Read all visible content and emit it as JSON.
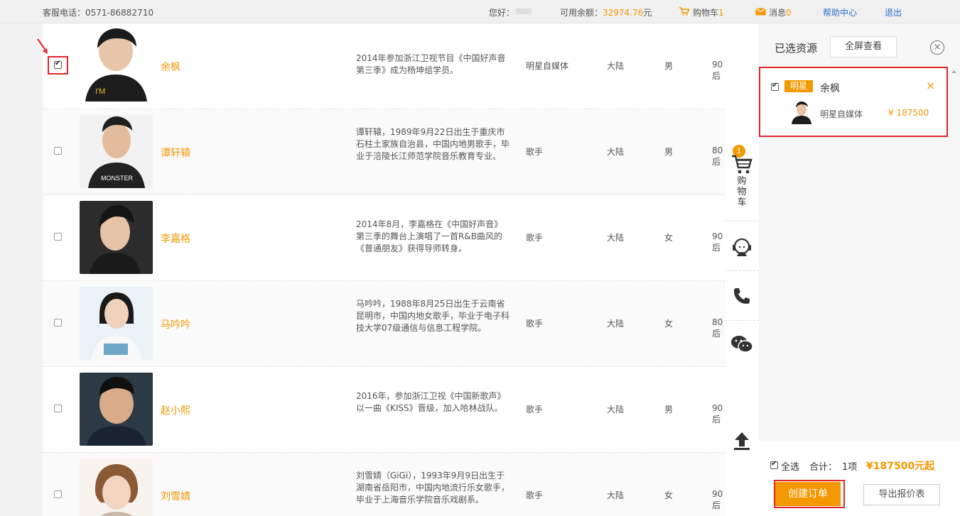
{
  "topbar": {
    "hotline_label": "客服电话：",
    "hotline": "0571-86882710",
    "greeting": "您好：",
    "balance_label": "可用余额：",
    "balance_value": "32974.76",
    "balance_unit": "元",
    "cart_label": "购物车",
    "cart_count": "1",
    "message_label": "消息",
    "message_count": "0",
    "help": "帮助中心",
    "logout": "退出"
  },
  "rows": [
    {
      "name": "余枫",
      "desc": "2014年参加浙江卫视节目《中国好声音第三季》成为杨坤组学员。",
      "category": "明星自媒体",
      "region": "大陆",
      "gender": "男",
      "age": "90后",
      "checked": true
    },
    {
      "name": "谭轩辕",
      "desc": "谭轩辕，1989年9月22日出生于重庆市石柱土家族自治县，中国内地男歌手，毕业于涪陵长江师范学院音乐教育专业。",
      "category": "歌手",
      "region": "大陆",
      "gender": "男",
      "age": "80后",
      "checked": false
    },
    {
      "name": "李嘉格",
      "desc": "2014年8月，李嘉格在《中国好声音》第三季的舞台上演唱了一首R&B曲风的《普通朋友》获得导师转身。",
      "category": "歌手",
      "region": "大陆",
      "gender": "女",
      "age": "90后",
      "checked": false
    },
    {
      "name": "马吟吟",
      "desc": "马吟吟，1988年8月25日出生于云南省昆明市，中国内地女歌手，毕业于电子科技大学07级通信与信息工程学院。",
      "category": "歌手",
      "region": "大陆",
      "gender": "女",
      "age": "80后",
      "checked": false
    },
    {
      "name": "赵小熙",
      "desc": "2016年，参加浙江卫视《中国新歌声》以一曲《KISS》晋级，加入哈林战队。",
      "category": "歌手",
      "region": "大陆",
      "gender": "男",
      "age": "90后",
      "checked": false
    },
    {
      "name": "刘雪婧",
      "desc": "刘雪婧（GiGi），1993年9月9日出生于湖南省岳阳市，中国内地流行乐女歌手，毕业于上海音乐学院音乐戏剧系。",
      "category": "歌手",
      "region": "大陆",
      "gender": "女",
      "age": "90后",
      "checked": false
    }
  ],
  "toolbar": {
    "cart_badge": "1",
    "cart_label": "购物车",
    "icons": [
      "cart-icon",
      "customer-service-icon",
      "phone-icon",
      "wechat-icon",
      "back-to-top-icon"
    ]
  },
  "panel": {
    "title": "已选资源",
    "fullscreen": "全屏查看",
    "close": "×",
    "item": {
      "tag": "明星",
      "name": "余枫",
      "category": "明星自媒体",
      "price": "¥ 187500",
      "remove": "×"
    }
  },
  "bottom": {
    "select_all": "全选",
    "total_label": "合计：",
    "total_count": "1项",
    "total_price": "¥187500元起",
    "create_order": "创建订单",
    "export": "导出报价表"
  },
  "colors": {
    "accent": "#f39800",
    "highlight_red": "#e2262b",
    "link_blue": "#2a6fc9"
  }
}
